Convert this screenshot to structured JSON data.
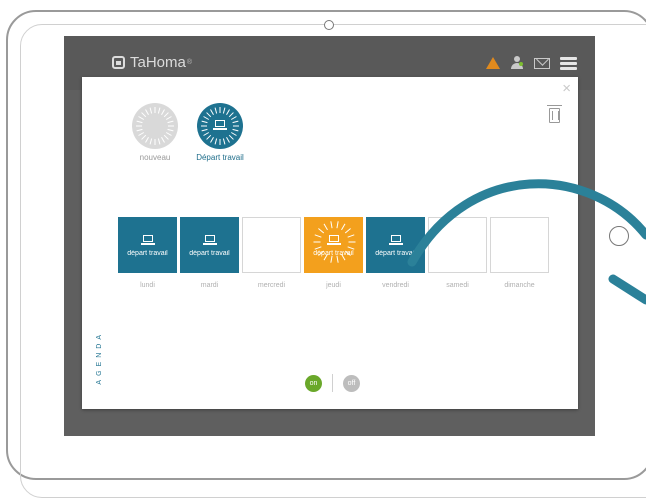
{
  "app": {
    "brand": "TaHoma",
    "brand_mark": "®"
  },
  "header_icons": [
    "warning-icon",
    "user-icon",
    "mail-icon",
    "menu-icon"
  ],
  "colors": {
    "primary": "#1e7290",
    "highlight": "#f3a01d",
    "on": "#6aa82a",
    "off": "#bdbdbd",
    "gesture": "#2b8199"
  },
  "scenarios": [
    {
      "label": "nouveau",
      "state": "new"
    },
    {
      "label": "Départ travail",
      "state": "active"
    }
  ],
  "agenda": {
    "title": "AGENDA",
    "days": [
      {
        "name": "lundi",
        "scenario": "départ travail",
        "state": "filled"
      },
      {
        "name": "mardi",
        "scenario": "départ travail",
        "state": "filled"
      },
      {
        "name": "mercredi",
        "scenario": "",
        "state": "empty"
      },
      {
        "name": "jeudi",
        "scenario": "départ travail",
        "state": "highlight"
      },
      {
        "name": "vendredi",
        "scenario": "départ travail",
        "state": "filled"
      },
      {
        "name": "samedi",
        "scenario": "",
        "state": "empty"
      },
      {
        "name": "dimanche",
        "scenario": "",
        "state": "empty"
      }
    ]
  },
  "toggle": {
    "on_label": "on",
    "off_label": "off",
    "selected": "on"
  },
  "panel": {
    "close_label": "×"
  }
}
